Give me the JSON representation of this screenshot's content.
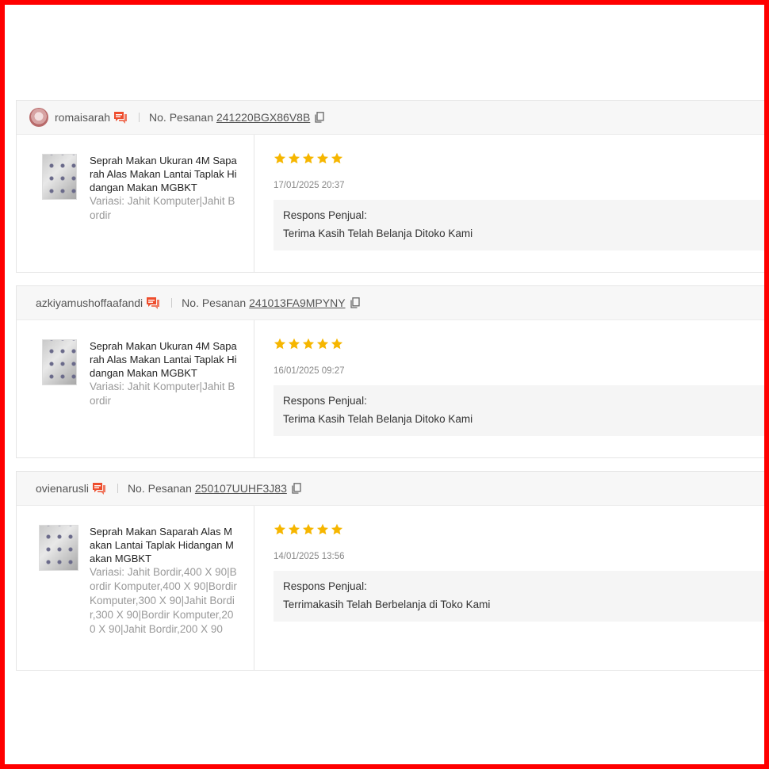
{
  "colors": {
    "frame": "#ff0000",
    "star": "#f6b600",
    "chat_icon": "#ee4d2d"
  },
  "labels": {
    "order": "No. Pesanan",
    "response": "Respons Penjual:"
  },
  "reviews": [
    {
      "username": "romaisarah",
      "has_avatar": true,
      "order_id": "241220BGX86V8B",
      "product_title": "Seprah Makan Ukuran 4M Saparah Alas Makan Lantai Taplak Hidangan Makan MGBKT",
      "variation": "Variasi: Jahit Komputer|Jahit Bordir",
      "stars": 5,
      "date": "17/01/2025 20:37",
      "seller_response": "Terima Kasih Telah Belanja Ditoko Kami"
    },
    {
      "username": "azkiyamushoffaafandi",
      "has_avatar": false,
      "order_id": "241013FA9MPYNY",
      "product_title": "Seprah Makan Ukuran 4M Saparah Alas Makan Lantai Taplak Hidangan Makan MGBKT",
      "variation": "Variasi: Jahit Komputer|Jahit Bordir",
      "stars": 5,
      "date": "16/01/2025 09:27",
      "seller_response": "Terima Kasih Telah Belanja Ditoko Kami"
    },
    {
      "username": "ovienarusli",
      "has_avatar": false,
      "order_id": "250107UUHF3J83",
      "product_title": "Seprah Makan Saparah Alas Makan Lantai Taplak Hidangan Makan MGBKT",
      "variation": "Variasi: Jahit Bordir,400 X 90|Bordir Komputer,400 X 90|Bordir Komputer,300 X 90|Jahit Bordir,300 X 90|Bordir Komputer,200 X 90|Jahit Bordir,200 X 90",
      "stars": 5,
      "date": "14/01/2025 13:56",
      "seller_response": "Terrimakasih Telah Berbelanja di Toko Kami"
    }
  ]
}
